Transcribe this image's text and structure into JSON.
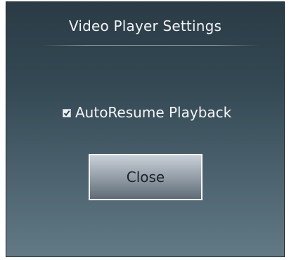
{
  "dialog": {
    "title": "Video Player Settings",
    "options": [
      {
        "label": "AutoResume Playback",
        "checked": true
      }
    ],
    "close_label": "Close"
  },
  "colors": {
    "background_top": "#2a3b45",
    "background_bottom": "#627a86",
    "text": "#f4f6f8"
  }
}
